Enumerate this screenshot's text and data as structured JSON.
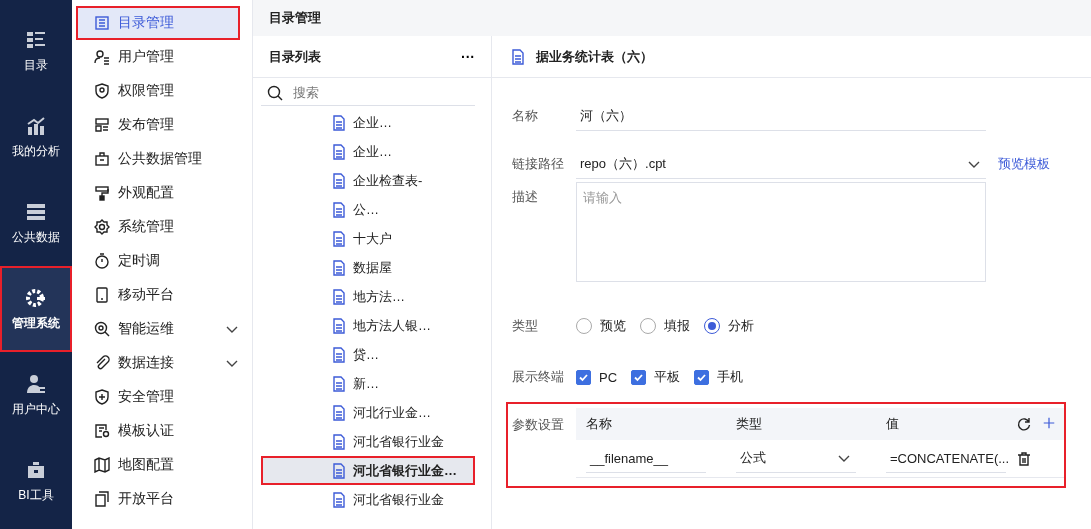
{
  "nav_rail": [
    {
      "label": "目录",
      "selected": false,
      "highlighted": false
    },
    {
      "label": "我的分析",
      "selected": false,
      "highlighted": false
    },
    {
      "label": "公共数据",
      "selected": false,
      "highlighted": false
    },
    {
      "label": "管理系统",
      "selected": true,
      "highlighted": true
    },
    {
      "label": "用户中心",
      "selected": false,
      "highlighted": false
    },
    {
      "label": "BI工具",
      "selected": false,
      "highlighted": false
    }
  ],
  "menu": [
    {
      "label": "目录管理",
      "selected": true,
      "highlighted": true,
      "expandable": false
    },
    {
      "label": "用户管理",
      "selected": false,
      "highlighted": false,
      "expandable": false
    },
    {
      "label": "权限管理",
      "selected": false,
      "highlighted": false,
      "expandable": false
    },
    {
      "label": "发布管理",
      "selected": false,
      "highlighted": false,
      "expandable": false
    },
    {
      "label": "公共数据管理",
      "selected": false,
      "highlighted": false,
      "expandable": false
    },
    {
      "label": "外观配置",
      "selected": false,
      "highlighted": false,
      "expandable": false
    },
    {
      "label": "系统管理",
      "selected": false,
      "highlighted": false,
      "expandable": false
    },
    {
      "label": "定时调",
      "selected": false,
      "highlighted": false,
      "expandable": false
    },
    {
      "label": "移动平台",
      "selected": false,
      "highlighted": false,
      "expandable": false
    },
    {
      "label": "智能运维",
      "selected": false,
      "highlighted": false,
      "expandable": true
    },
    {
      "label": "数据连接",
      "selected": false,
      "highlighted": false,
      "expandable": true
    },
    {
      "label": "安全管理",
      "selected": false,
      "highlighted": false,
      "expandable": false
    },
    {
      "label": "模板认证",
      "selected": false,
      "highlighted": false,
      "expandable": false
    },
    {
      "label": "地图配置",
      "selected": false,
      "highlighted": false,
      "expandable": false
    },
    {
      "label": "开放平台",
      "selected": false,
      "highlighted": false,
      "expandable": false
    }
  ],
  "header": {
    "title": "目录管理"
  },
  "catalog": {
    "title": "目录列表",
    "more": "···",
    "search": {
      "placeholder": "搜索"
    },
    "items": [
      {
        "label": "企业…",
        "selected": false,
        "highlighted": false
      },
      {
        "label": "企业…",
        "selected": false,
        "highlighted": false
      },
      {
        "label": "企业检查表-",
        "selected": false,
        "highlighted": false
      },
      {
        "label": "公…",
        "selected": false,
        "highlighted": false
      },
      {
        "label": "十大户",
        "selected": false,
        "highlighted": false
      },
      {
        "label": "数据屋",
        "selected": false,
        "highlighted": false
      },
      {
        "label": "地方法…",
        "selected": false,
        "highlighted": false
      },
      {
        "label": "地方法人银…",
        "selected": false,
        "highlighted": false
      },
      {
        "label": "贷…",
        "selected": false,
        "highlighted": false
      },
      {
        "label": "新…",
        "selected": false,
        "highlighted": false
      },
      {
        "label": "河北行业金…",
        "selected": false,
        "highlighted": false
      },
      {
        "label": "河北省银行业金",
        "selected": false,
        "highlighted": false
      },
      {
        "label": "河北省银行业金…",
        "selected": true,
        "highlighted": true
      },
      {
        "label": "河北省银行业金",
        "selected": false,
        "highlighted": false
      }
    ]
  },
  "detail": {
    "title": "据业务统计表（六）",
    "fields": [
      {
        "kind": "text",
        "label": "名称",
        "value": "河（六）"
      },
      {
        "kind": "select",
        "label": "链接路径",
        "value": "repo（六）.cpt",
        "link": "预览模板"
      },
      {
        "kind": "textarea",
        "label": "描述",
        "placeholder": "请输入"
      },
      {
        "kind": "radio",
        "label": "类型",
        "options": [
          {
            "label": "预览",
            "selected": false
          },
          {
            "label": "填报",
            "selected": false
          },
          {
            "label": "分析",
            "selected": true
          }
        ]
      },
      {
        "kind": "checkbox",
        "label": "展示终端",
        "options": [
          {
            "label": "PC",
            "checked": true
          },
          {
            "label": "平板",
            "checked": true
          },
          {
            "label": "手机",
            "checked": true
          }
        ]
      }
    ],
    "params": {
      "label": "参数设置",
      "highlighted": true,
      "columns": [
        "名称",
        "类型",
        "值"
      ],
      "rows": [
        {
          "name": "__filename__",
          "type": "公式",
          "value": "=CONCATENATE(..."
        }
      ]
    }
  }
}
